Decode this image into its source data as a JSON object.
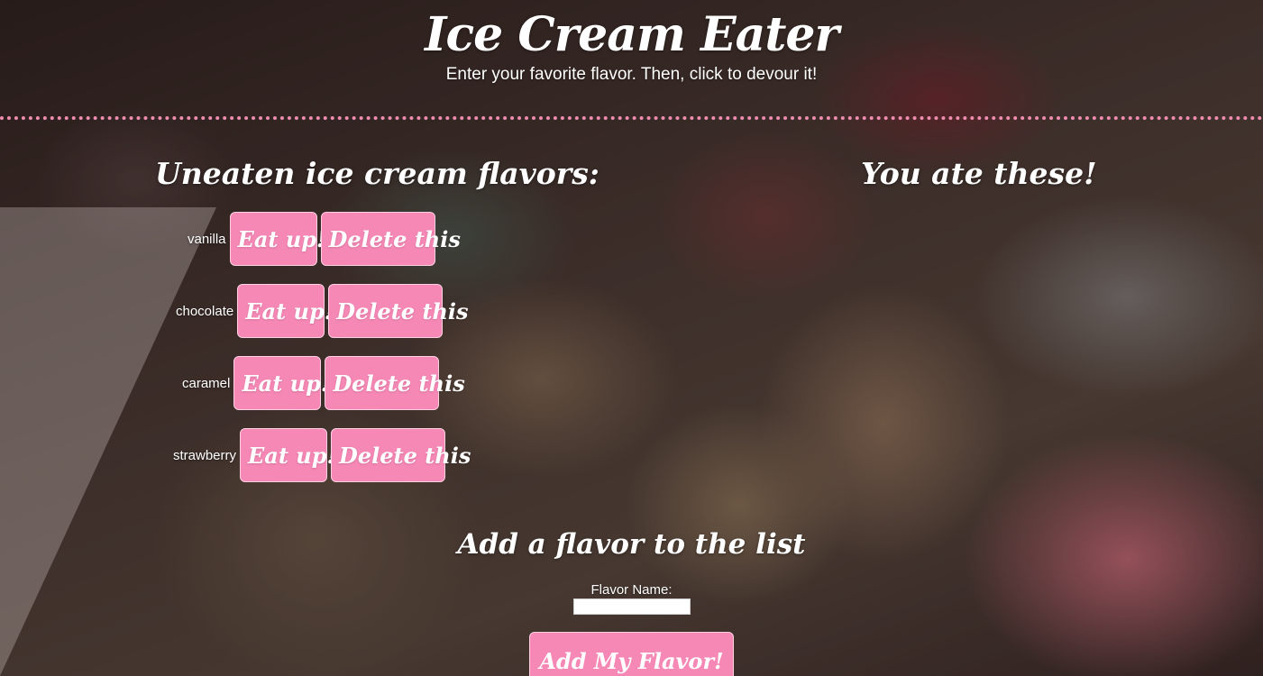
{
  "header": {
    "title": "Ice Cream Eater",
    "subtitle": "Enter your favorite flavor. Then, click to devour it!"
  },
  "uneaten": {
    "heading": "Uneaten ice cream flavors:",
    "eat_label": "Eat up!",
    "delete_label": "Delete this",
    "flavors": [
      "vanilla",
      "chocolate",
      "caramel",
      "strawberry"
    ]
  },
  "eaten": {
    "heading": "You ate these!",
    "flavors": []
  },
  "add_form": {
    "heading": "Add a flavor to the list",
    "field_label": "Flavor Name:",
    "field_value": "",
    "submit_label": "Add My Flavor!"
  },
  "colors": {
    "button_pink": "#f688b6",
    "divider_pink": "#f08cb0",
    "text": "#ffffff"
  }
}
